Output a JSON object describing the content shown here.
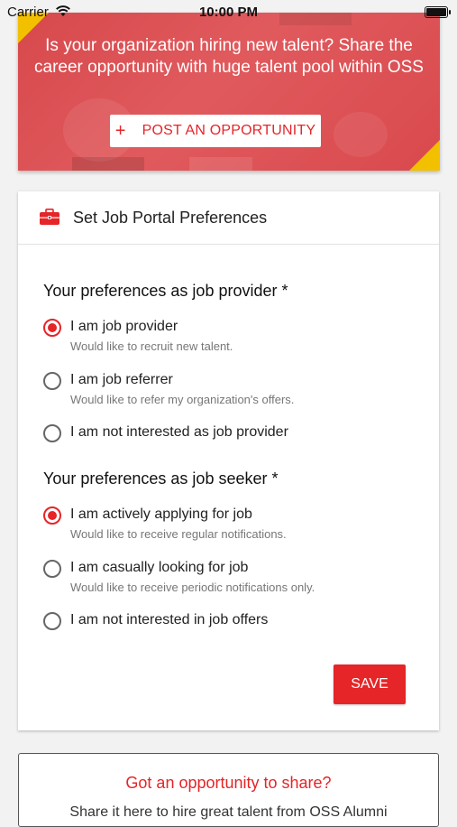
{
  "status_bar": {
    "carrier": "Carrier",
    "time": "10:00 PM"
  },
  "banner": {
    "message": "Is your organization hiring new talent? Share the career opportunity with huge talent pool within OSS",
    "post_button_icon": "+",
    "post_button_label": "POST AN OPPORTUNITY"
  },
  "preferences": {
    "title": "Set Job Portal Preferences",
    "provider_section": {
      "title": "Your preferences as job provider *",
      "options": [
        {
          "label": "I am job provider",
          "description": "Would like to recruit new talent.",
          "checked": true
        },
        {
          "label": "I am job referrer",
          "description": "Would like to refer my organization's offers.",
          "checked": false
        },
        {
          "label": "I am not interested as job provider",
          "description": "",
          "checked": false
        }
      ]
    },
    "seeker_section": {
      "title": "Your preferences as job seeker *",
      "options": [
        {
          "label": "I am actively applying for job",
          "description": "Would like to receive regular notifications.",
          "checked": true
        },
        {
          "label": "I am casually looking for job",
          "description": "Would like to receive periodic notifications only.",
          "checked": false
        },
        {
          "label": "I am not interested in job offers",
          "description": "",
          "checked": false
        }
      ]
    },
    "save_label": "SAVE"
  },
  "share": {
    "title": "Got an opportunity to share?",
    "text": "Share it here to hire great talent from OSS Alumni"
  },
  "colors": {
    "accent": "#e52528",
    "banner": "#d9494d",
    "corner": "#f3c000"
  }
}
